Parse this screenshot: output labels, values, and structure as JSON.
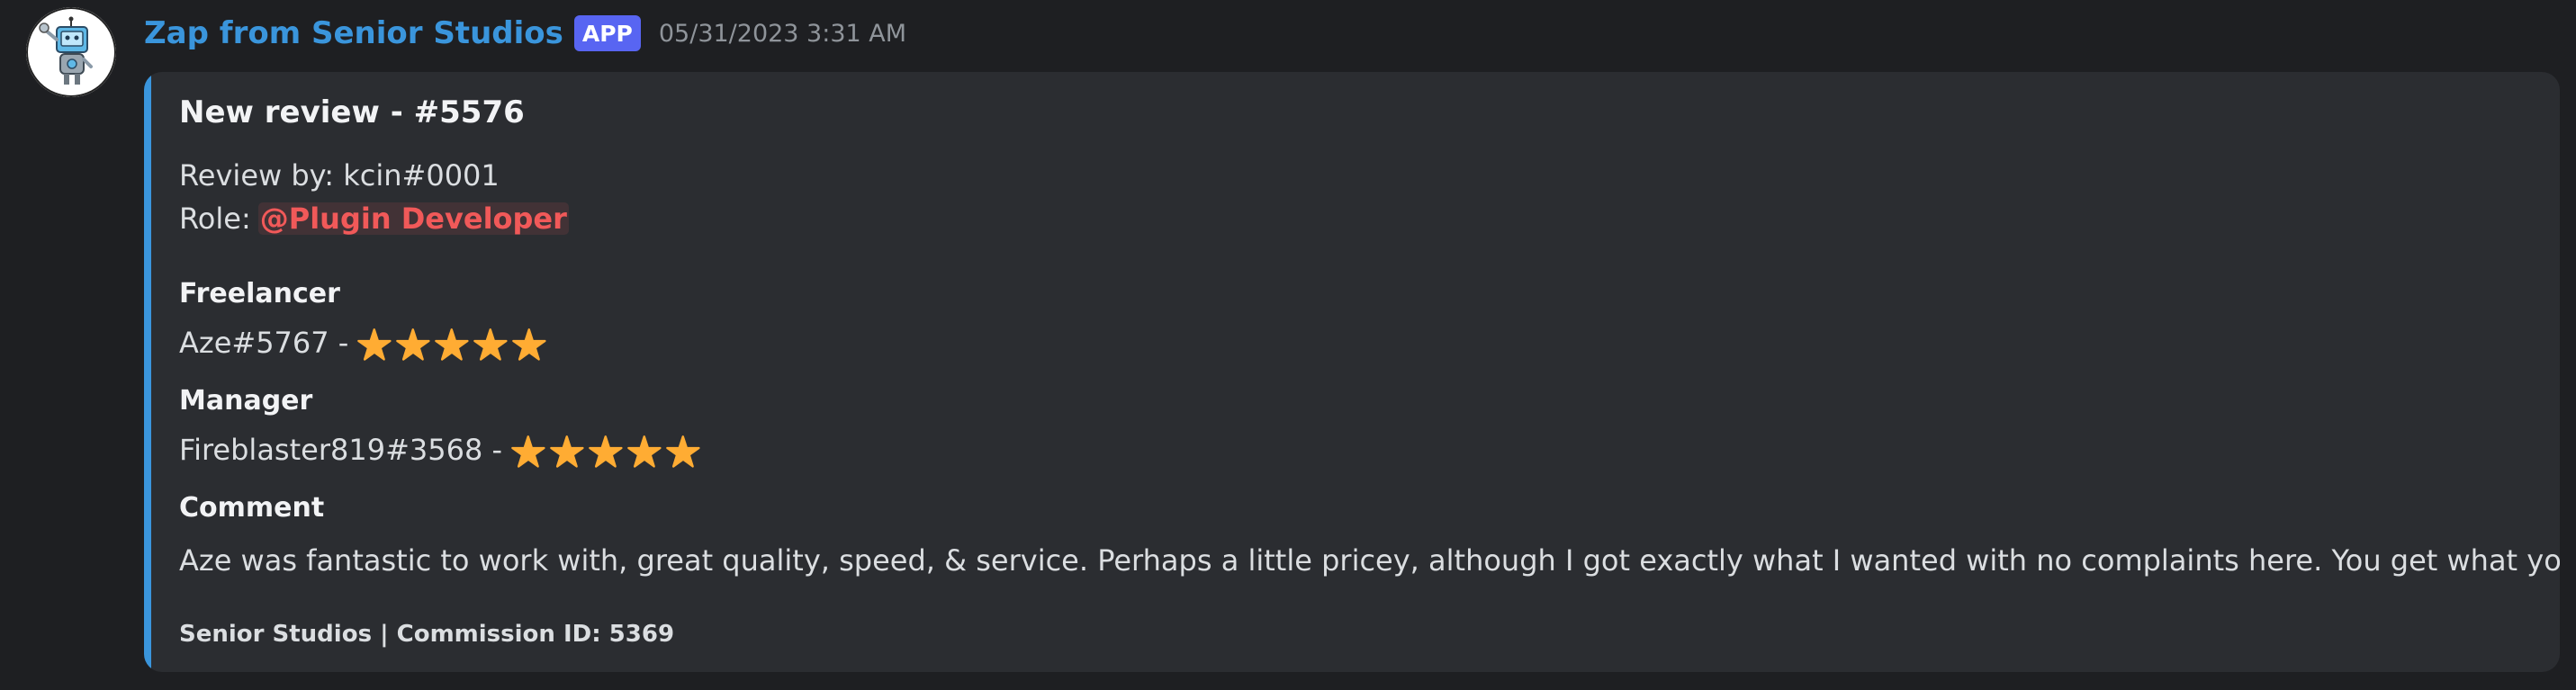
{
  "message": {
    "author": "Zap from Senior Studios",
    "badge": "APP",
    "timestamp": "05/31/2023 3:31 AM"
  },
  "embed": {
    "accent_color": "#3a95dc",
    "title": "New review - #5576",
    "review_by": "Review by: kcin#0001",
    "role_label": "Role:",
    "role_mention": "@Plugin Developer",
    "fields": [
      {
        "name": "Freelancer",
        "value": "Aze#5767 -",
        "stars": 5
      },
      {
        "name": "Manager",
        "value": "Fireblaster819#3568 -",
        "stars": 5
      },
      {
        "name": "Comment",
        "value": "Aze was fantastic to work with, great quality, speed,  & service. Perhaps a little pricey, although I got exactly what I wanted with no complaints here. You get what you pay for."
      }
    ],
    "footer": "Senior Studios | Commission ID: 5369"
  },
  "icons": {
    "avatar": "robot-avatar-icon",
    "star": "star-icon"
  },
  "colors": {
    "background": "#1e1f22",
    "embed_background": "#2b2d31",
    "author": "#3a95dc",
    "badge": "#5865f2",
    "mention": "#f15959",
    "star": "#ffac33"
  }
}
